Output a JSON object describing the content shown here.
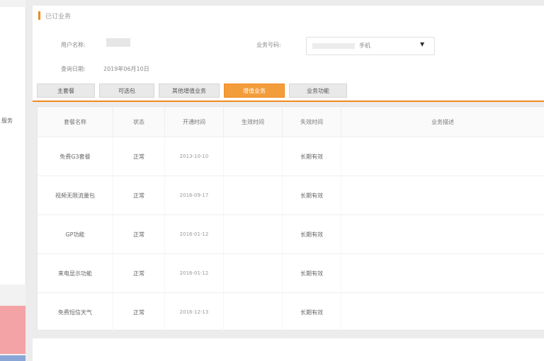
{
  "sidebar": {
    "label": "服务"
  },
  "header": {
    "title": "已订业务",
    "account_label": "用户名称:",
    "business_label": "业务号码:",
    "business_value": "手机",
    "time_label": "查询日期:",
    "time_value": "2019年06月10日"
  },
  "tabs": [
    {
      "label": "主套餐"
    },
    {
      "label": "可选包"
    },
    {
      "label": "其他增值业务"
    },
    {
      "label": "增值业务"
    },
    {
      "label": "业务功能"
    }
  ],
  "table": {
    "headers": [
      "套餐名称",
      "状态",
      "开通时间",
      "生效时间",
      "失效时间",
      "业务描述"
    ],
    "rows": [
      {
        "name": "免费G3套餐",
        "status": "正常",
        "start": "2013-10-10",
        "effective": "",
        "expire": "长期有效",
        "desc": ""
      },
      {
        "name": "视频无限流量包",
        "status": "正常",
        "start": "2016-09-17",
        "effective": "",
        "expire": "长期有效",
        "desc": ""
      },
      {
        "name": "GP功能",
        "status": "正常",
        "start": "2016-01-12",
        "effective": "",
        "expire": "长期有效",
        "desc": ""
      },
      {
        "name": "来电显示功能",
        "status": "正常",
        "start": "2016-01-12",
        "effective": "",
        "expire": "长期有效",
        "desc": ""
      },
      {
        "name": "免费短信天气",
        "status": "正常",
        "start": "2016-12-13",
        "effective": "",
        "expire": "长期有效",
        "desc": ""
      }
    ]
  },
  "colors": {
    "accent": "#f08a1e",
    "active_tab": "#f39c3c"
  }
}
